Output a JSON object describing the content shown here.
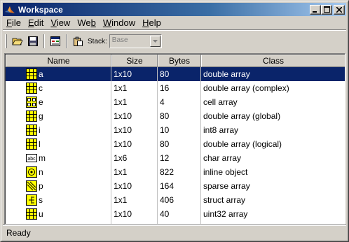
{
  "window": {
    "title": "Workspace",
    "controls": [
      "minimize",
      "maximize",
      "close"
    ]
  },
  "menu": [
    {
      "pre": "",
      "ul": "F",
      "post": "ile"
    },
    {
      "pre": "",
      "ul": "E",
      "post": "dit"
    },
    {
      "pre": "",
      "ul": "V",
      "post": "iew"
    },
    {
      "pre": "We",
      "ul": "b",
      "post": ""
    },
    {
      "pre": "",
      "ul": "W",
      "post": "indow"
    },
    {
      "pre": "",
      "ul": "H",
      "post": "elp"
    }
  ],
  "toolbar": {
    "buttons": [
      "open-folder-icon",
      "save-icon",
      "import-data-icon",
      "paste-icon"
    ],
    "stack_label": "Stack:",
    "stack_value": "Base"
  },
  "table": {
    "headers": [
      "Name",
      "Size",
      "Bytes",
      "Class"
    ],
    "rows": [
      {
        "icon": "matrix-icon",
        "name": "a",
        "size": "1x10",
        "bytes": "80",
        "class": "double array",
        "selected": true
      },
      {
        "icon": "matrix-icon",
        "name": "c",
        "size": "1x1",
        "bytes": "16",
        "class": "double array (complex)",
        "selected": false
      },
      {
        "icon": "cell-array-icon",
        "name": "e",
        "size": "1x1",
        "bytes": "4",
        "class": "cell array",
        "selected": false
      },
      {
        "icon": "matrix-icon",
        "name": "g",
        "size": "1x10",
        "bytes": "80",
        "class": "double array (global)",
        "selected": false
      },
      {
        "icon": "matrix-icon",
        "name": "i",
        "size": "1x10",
        "bytes": "10",
        "class": "int8 array",
        "selected": false
      },
      {
        "icon": "matrix-icon",
        "name": "l",
        "size": "1x10",
        "bytes": "80",
        "class": "double array (logical)",
        "selected": false
      },
      {
        "icon": "char-array-icon",
        "name": "m",
        "size": "1x6",
        "bytes": "12",
        "class": "char array",
        "selected": false
      },
      {
        "icon": "inline-object-icon",
        "name": "n",
        "size": "1x1",
        "bytes": "822",
        "class": "inline object",
        "selected": false
      },
      {
        "icon": "sparse-array-icon",
        "name": "p",
        "size": "1x10",
        "bytes": "164",
        "class": "sparse array",
        "selected": false
      },
      {
        "icon": "struct-array-icon",
        "name": "s",
        "size": "1x1",
        "bytes": "406",
        "class": "struct array",
        "selected": false
      },
      {
        "icon": "matrix-icon",
        "name": "u",
        "size": "1x10",
        "bytes": "40",
        "class": "uint32 array",
        "selected": false
      }
    ]
  },
  "status": {
    "text": "Ready"
  },
  "colors": {
    "title_bar_start": "#0a246a",
    "title_bar_end": "#a6caf0",
    "selection": "#0a246a",
    "icon_fill": "#ffff00"
  }
}
